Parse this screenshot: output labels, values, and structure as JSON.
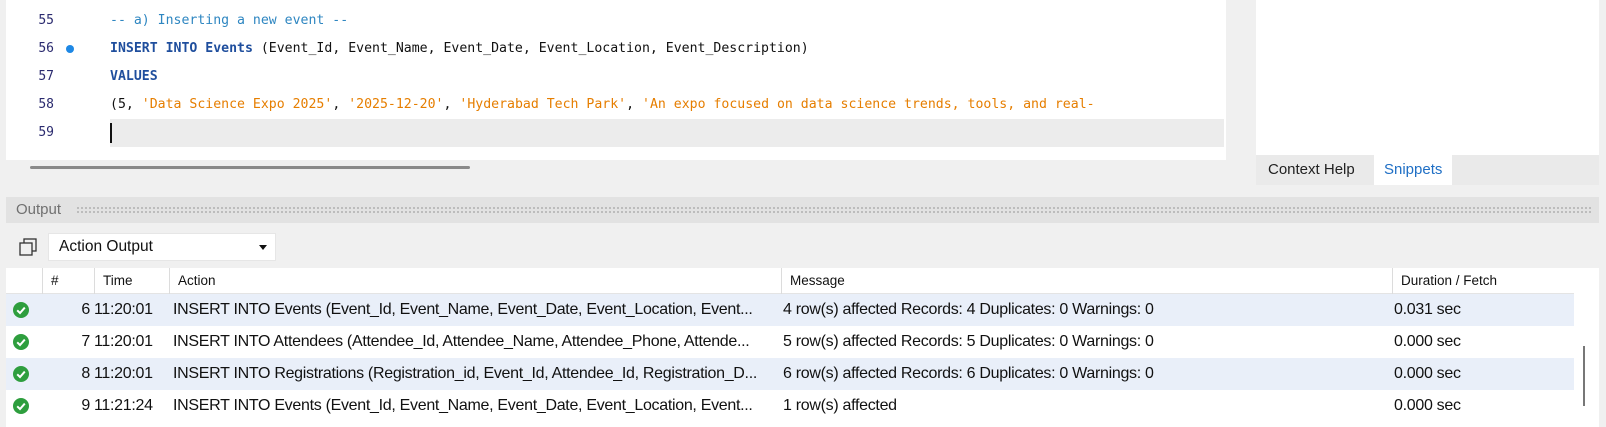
{
  "editor": {
    "lines": [
      {
        "num": "55",
        "tokens": [
          {
            "t": "comment",
            "v": "-- a) Inserting a new event --"
          }
        ]
      },
      {
        "num": "56",
        "breakpoint": true,
        "tokens": [
          {
            "t": "kw",
            "v": "INSERT INTO Events "
          },
          {
            "t": "plain",
            "v": "(Event_Id, Event_Name, Event_Date, Event_Location, Event_Description)"
          }
        ]
      },
      {
        "num": "57",
        "tokens": [
          {
            "t": "kw",
            "v": "VALUES"
          }
        ]
      },
      {
        "num": "58",
        "tokens": [
          {
            "t": "plain",
            "v": "(5, "
          },
          {
            "t": "str",
            "v": "'Data Science Expo 2025'"
          },
          {
            "t": "plain",
            "v": ", "
          },
          {
            "t": "str",
            "v": "'2025-12-20'"
          },
          {
            "t": "plain",
            "v": ", "
          },
          {
            "t": "str",
            "v": "'Hyderabad Tech Park'"
          },
          {
            "t": "plain",
            "v": ", "
          },
          {
            "t": "str",
            "v": "'An expo focused on data science trends, tools, and real-"
          }
        ]
      },
      {
        "num": "59",
        "current": true,
        "tokens": []
      }
    ]
  },
  "right_panel": {
    "tabs": [
      {
        "label": "Context Help",
        "active": false
      },
      {
        "label": "Snippets",
        "active": true
      }
    ]
  },
  "output": {
    "title": "Output",
    "selector_value": "Action Output",
    "columns": {
      "num": "#",
      "time": "Time",
      "action": "Action",
      "message": "Message",
      "duration": "Duration / Fetch"
    },
    "rows": [
      {
        "num": "6",
        "time": "11:20:01",
        "action": "INSERT INTO Events (Event_Id, Event_Name, Event_Date, Event_Location, Event...",
        "message": "4 row(s) affected Records: 4  Duplicates: 0  Warnings: 0",
        "duration": "0.031 sec",
        "status": "success"
      },
      {
        "num": "7",
        "time": "11:20:01",
        "action": "INSERT INTO Attendees (Attendee_Id, Attendee_Name, Attendee_Phone, Attende...",
        "message": "5 row(s) affected Records: 5  Duplicates: 0  Warnings: 0",
        "duration": "0.000 sec",
        "status": "success"
      },
      {
        "num": "8",
        "time": "11:20:01",
        "action": "INSERT INTO Registrations (Registration_id, Event_Id, Attendee_Id, Registration_D...",
        "message": "6 row(s) affected Records: 6  Duplicates: 0  Warnings: 0",
        "duration": "0.000 sec",
        "status": "success"
      },
      {
        "num": "9",
        "time": "11:21:24",
        "action": "INSERT INTO Events (Event_Id, Event_Name, Event_Date, Event_Location, Event...",
        "message": "1 row(s) affected",
        "duration": "0.000 sec",
        "status": "success"
      }
    ]
  },
  "colors": {
    "success": "#2e9e3e",
    "accent": "#1f6fc5",
    "breakpoint": "#1e88e5"
  },
  "icons": {
    "status": "check-circle-icon",
    "copy": "copy-icon",
    "dropdown": "chevron-down-icon"
  }
}
